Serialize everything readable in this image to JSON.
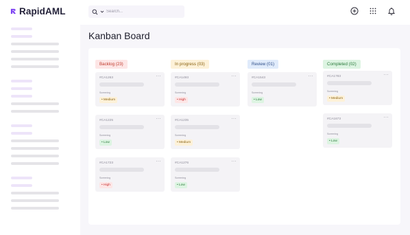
{
  "app": {
    "name": "RapidAML"
  },
  "search": {
    "placeholder": "Search..."
  },
  "page": {
    "title": "Kanban Board"
  },
  "header_icons": [
    "add-circle-icon",
    "grid-icon",
    "bell-icon"
  ],
  "columns": [
    {
      "title": "Backlog (23)",
      "colors": {
        "bg": "#fde6e6",
        "fg": "#c0392b"
      },
      "cards": [
        {
          "id": "#CA1263",
          "stage": "Screening",
          "priority": "• Medium",
          "level": "medium"
        },
        {
          "id": "#CA1225",
          "stage": "Screening",
          "priority": "• Low",
          "level": "low"
        },
        {
          "id": "#CA1723",
          "stage": "Screening",
          "priority": "• High",
          "level": "high"
        }
      ]
    },
    {
      "title": "In progress (03)",
      "colors": {
        "bg": "#fdf1d8",
        "fg": "#8a6210"
      },
      "cards": [
        {
          "id": "#CA1493",
          "stage": "Screening",
          "priority": "• High",
          "level": "high"
        },
        {
          "id": "#CA1235",
          "stage": "Screening",
          "priority": "• Medium",
          "level": "medium"
        },
        {
          "id": "#CA1276",
          "stage": "Screening",
          "priority": "• Low",
          "level": "low"
        }
      ]
    },
    {
      "title": "Review (01)",
      "colors": {
        "bg": "#e0ebfb",
        "fg": "#2f4f8a"
      },
      "cards": [
        {
          "id": "#CA1543",
          "stage": "Screening",
          "priority": "• Low",
          "level": "low"
        }
      ]
    },
    {
      "title": "Completed (02)",
      "colors": {
        "bg": "#ddf4e2",
        "fg": "#2a7a3b"
      },
      "cards": [
        {
          "id": "#CA1783",
          "stage": "Screening",
          "priority": "• Medium",
          "level": "medium"
        },
        {
          "id": "#CA1673",
          "stage": "Screening",
          "priority": "• Low",
          "level": "low"
        }
      ]
    }
  ],
  "card_menu_label": "···",
  "colors": {
    "brand": "#7b3ff2",
    "accent_light": "#ede4f9"
  }
}
